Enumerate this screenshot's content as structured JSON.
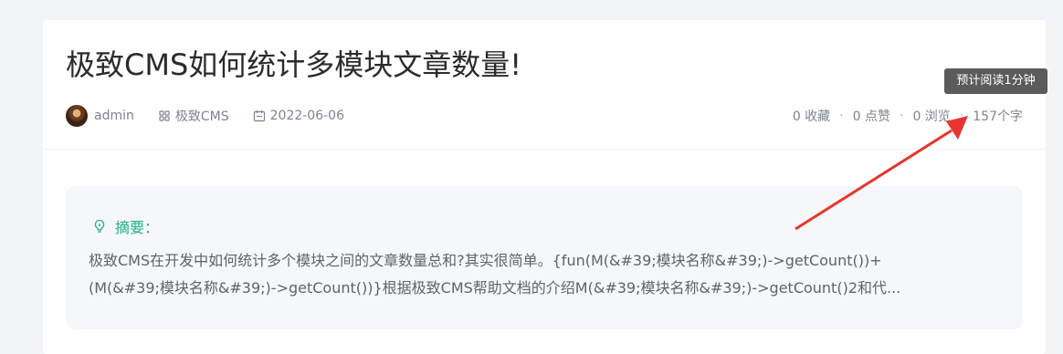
{
  "article": {
    "title": "极致CMS如何统计多模块文章数量!",
    "meta": {
      "author": "admin",
      "category": "极致CMS",
      "date": "2022-06-06",
      "favorites": "0 收藏",
      "likes": "0 点赞",
      "views": "0 浏览",
      "word_count": "157个字",
      "separator": "·"
    },
    "summary": {
      "label": "摘要：",
      "line1": "极致CMS在开发中如何统计多个模块之间的文章数量总和?其实很简单。{fun(M(&#39;模块名称&#39;)->getCount())+",
      "line2": "(M(&#39;模块名称&#39;)->getCount())}根据极致CMS帮助文档的介绍M(&#39;模块名称&#39;)->getCount()2和代..."
    }
  },
  "tooltip": {
    "text": "预计阅读1分钟"
  },
  "icons": {
    "category": "grid-icon",
    "date": "calendar-icon",
    "summary": "lightbulb-icon"
  },
  "colors": {
    "accent": "#1fb28a",
    "annotation_arrow": "#e8352e",
    "meta_text": "#7b8492"
  }
}
